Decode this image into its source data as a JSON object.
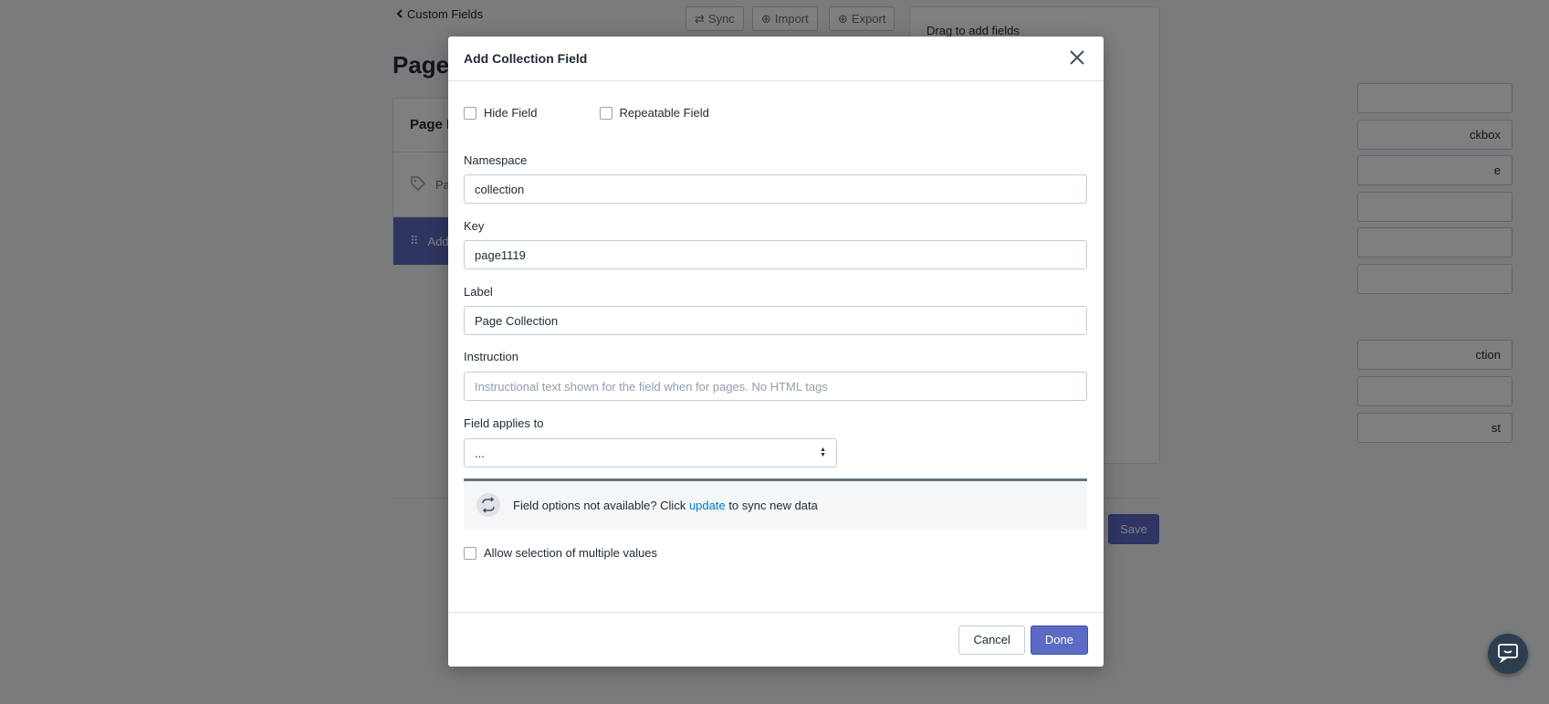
{
  "background": {
    "back_link": "Custom Fields",
    "toolbar": {
      "sync": "Sync",
      "import": "Import",
      "export": "Export"
    },
    "page_title": "Page",
    "card": {
      "heading": "Page F",
      "row_label": "Pa",
      "active_label": "Add"
    },
    "right_panel": {
      "title": "Drag to add fields",
      "items": [
        "",
        "ckbox",
        "e",
        "",
        "",
        "",
        "ction",
        "",
        "st"
      ]
    },
    "save_label": "Save"
  },
  "modal": {
    "title": "Add Collection Field",
    "options": {
      "hide_field": "Hide Field",
      "repeatable_field": "Repeatable Field"
    },
    "namespace": {
      "label": "Namespace",
      "value": "collection"
    },
    "key": {
      "label": "Key",
      "value": "page1119"
    },
    "label_field": {
      "label": "Label",
      "value": "Page Collection"
    },
    "instruction": {
      "label": "Instruction",
      "placeholder": "Instructional text shown for the field when for pages. No HTML tags"
    },
    "applies_to": {
      "label": "Field applies to",
      "selected": "..."
    },
    "sync_banner": {
      "text_before": "Field options not available? Click ",
      "link": "update",
      "text_after": " to sync new data"
    },
    "multi_select_label": "Allow selection of multiple values",
    "footer": {
      "cancel": "Cancel",
      "done": "Done"
    }
  },
  "colors": {
    "primary": "#5c6ac4",
    "link": "#007ace",
    "border": "#c4cdd5"
  }
}
